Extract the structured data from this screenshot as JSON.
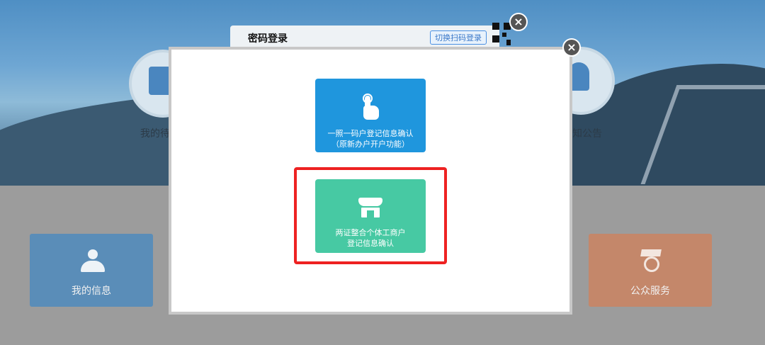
{
  "background": {
    "login": {
      "title": "密码登录",
      "switch_label": "切换扫码登录"
    },
    "hero_left_label": "我的待",
    "hero_right_label": "知公告",
    "tiles": {
      "my_info": "我的信息",
      "public_service": "公众服务"
    }
  },
  "modal": {
    "close_symbol": "×",
    "options": [
      {
        "label": "一照一码户登记信息确认\n（原新办户开户功能）",
        "color": "#1f96dd",
        "icon": "hand-pointer-icon"
      },
      {
        "label": "两证整合个体工商户\n登记信息确认",
        "color": "#47c9a3",
        "icon": "storefront-icon"
      }
    ],
    "highlight_color": "#ee2222"
  },
  "login_close_symbol": "×"
}
